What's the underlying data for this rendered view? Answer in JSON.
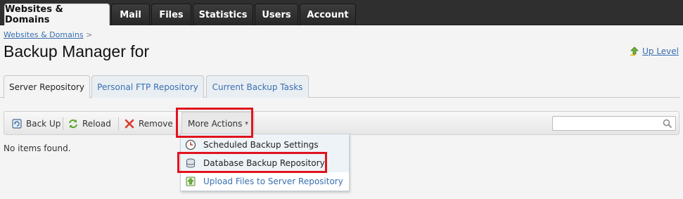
{
  "top_tabs": [
    {
      "label": "Websites & Domains",
      "active": true
    },
    {
      "label": "Mail",
      "active": false
    },
    {
      "label": "Files",
      "active": false
    },
    {
      "label": "Statistics",
      "active": false
    },
    {
      "label": "Users",
      "active": false
    },
    {
      "label": "Account",
      "active": false
    }
  ],
  "breadcrumb": {
    "link": "Websites & Domains",
    "separator": ">"
  },
  "page_title": "Backup Manager for",
  "up_level": {
    "label": "Up Level",
    "icon": "up-arrow-icon"
  },
  "sub_tabs": [
    {
      "label": "Server Repository",
      "active": true
    },
    {
      "label": "Personal FTP Repository",
      "active": false
    },
    {
      "label": "Current Backup Tasks",
      "active": false
    }
  ],
  "toolbar": {
    "back_up": {
      "label": "Back Up",
      "icon": "backup-icon"
    },
    "reload": {
      "label": "Reload",
      "icon": "reload-icon"
    },
    "remove": {
      "label": "Remove",
      "icon": "remove-icon"
    },
    "more_actions": {
      "label": "More Actions",
      "caret": "▾"
    },
    "search": {
      "value": "",
      "placeholder": "",
      "icon": "search-icon"
    }
  },
  "empty_message": "No items found.",
  "dropdown": {
    "items": [
      {
        "label": "Scheduled Backup Settings",
        "icon": "clock-icon"
      },
      {
        "label": "Database Backup Repository",
        "icon": "database-icon"
      },
      {
        "label": "Upload Files to Server Repository",
        "icon": "upload-icon"
      }
    ]
  },
  "colors": {
    "highlight": "#e0141e",
    "link": "#3a6fb0",
    "topbar": "#2f2f2f"
  }
}
